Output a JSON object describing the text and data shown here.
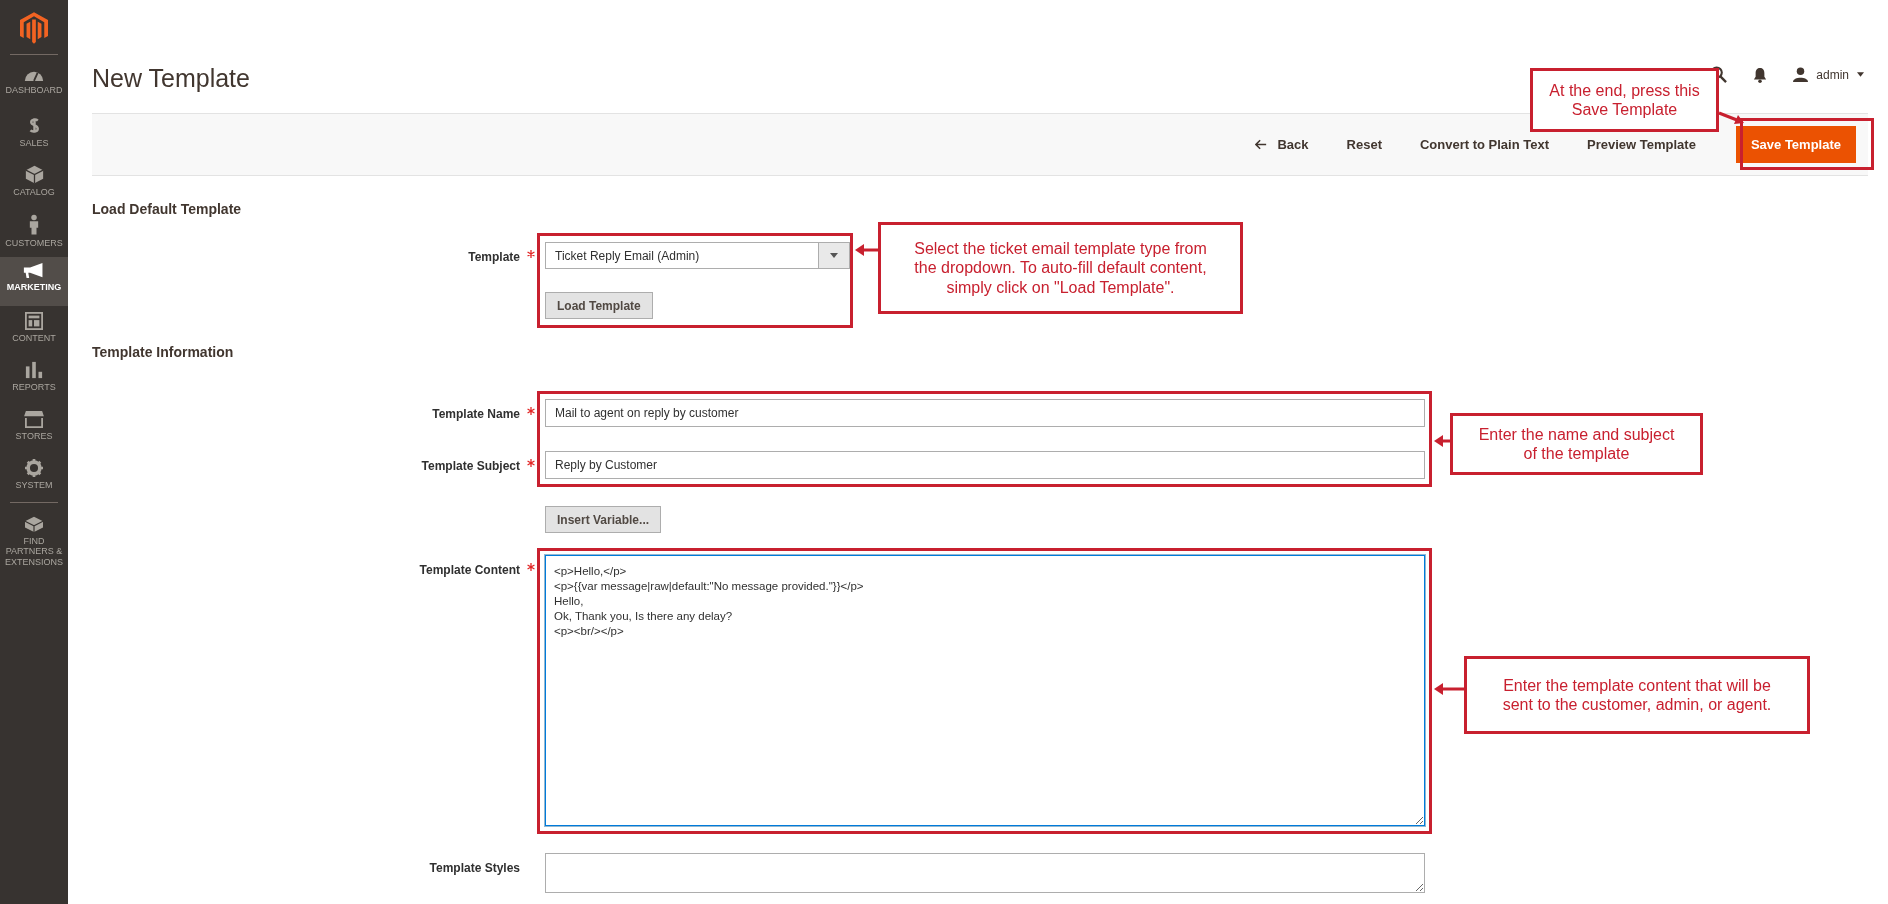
{
  "sidebar": {
    "items": [
      {
        "label": "DASHBOARD",
        "selected": false
      },
      {
        "label": "SALES",
        "selected": false
      },
      {
        "label": "CATALOG",
        "selected": false
      },
      {
        "label": "CUSTOMERS",
        "selected": false
      },
      {
        "label": "MARKETING",
        "selected": true
      },
      {
        "label": "CONTENT",
        "selected": false
      },
      {
        "label": "REPORTS",
        "selected": false
      },
      {
        "label": "STORES",
        "selected": false
      },
      {
        "label": "SYSTEM",
        "selected": false
      },
      {
        "label": "FIND PARTNERS & EXTENSIONS",
        "selected": false
      }
    ]
  },
  "page_title": "New Template",
  "header": {
    "user": "admin"
  },
  "actions": [
    {
      "label": "Back",
      "kind": "back"
    },
    {
      "label": "Reset",
      "kind": "link"
    },
    {
      "label": "Convert to Plain Text",
      "kind": "link"
    },
    {
      "label": "Preview Template",
      "kind": "link"
    },
    {
      "label": "Save Template",
      "kind": "primary"
    }
  ],
  "load_default": {
    "title": "Load Default Template",
    "field": {
      "label": "Template",
      "required": true,
      "value": "Ticket Reply Email (Admin)"
    },
    "button": "Load Template"
  },
  "template_information": {
    "title": "Template Information",
    "fields": [
      {
        "kind": "input",
        "label": "Template Name",
        "required": true,
        "value": "Mail to agent on reply by customer"
      },
      {
        "kind": "input",
        "label": "Template Subject",
        "required": true,
        "value": "Reply by Customer"
      },
      {
        "kind": "button",
        "label": "Insert Variable..."
      },
      {
        "kind": "content",
        "label": "Template Content",
        "required": true,
        "value": "<p>Hello,</p>\n<p>{{var message|raw|default:\"No message provided.\"}}</p>\nHello,\nOk, Thank you, Is there any delay?\n<p><br/></p>"
      },
      {
        "kind": "styles",
        "label": "Template Styles",
        "required": false
      }
    ]
  },
  "annotations": [
    {
      "text": "At the end, press this\nSave Template"
    },
    {
      "text": "Select the ticket email template type from\nthe dropdown. To auto-fill default content,\nsimply click on \"Load Template\"."
    },
    {
      "text": "Enter the name and subject\nof the template"
    },
    {
      "text": "Enter the template content that will be\nsent to the customer, admin, or agent."
    }
  ]
}
